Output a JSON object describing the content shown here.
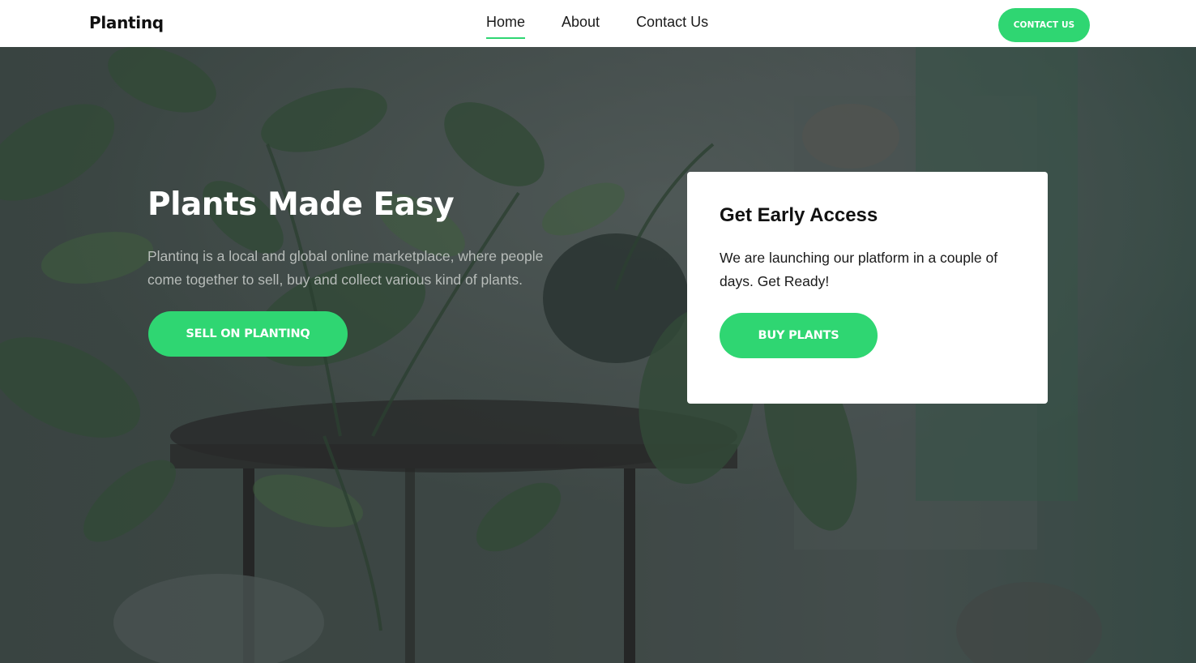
{
  "nav": {
    "brand": "Plantinq",
    "links": [
      {
        "label": "Home",
        "active": true
      },
      {
        "label": "About",
        "active": false
      },
      {
        "label": "Contact Us",
        "active": false
      }
    ],
    "cta_label": "CONTACT US"
  },
  "hero": {
    "title": "Plants Made Easy",
    "subtitle": "Plantinq is a local and global online marketplace, where people come together to sell, buy and collect various kind of plants.",
    "button_label": "SELL ON PLANTINQ"
  },
  "card": {
    "title": "Get Early Access",
    "text": "We are launching our platform in a couple of days. Get Ready!",
    "button_label": "BUY PLANTS"
  },
  "colors": {
    "accent": "#2fd672",
    "hero_overlay": "#283034",
    "text_dark": "#111111"
  }
}
